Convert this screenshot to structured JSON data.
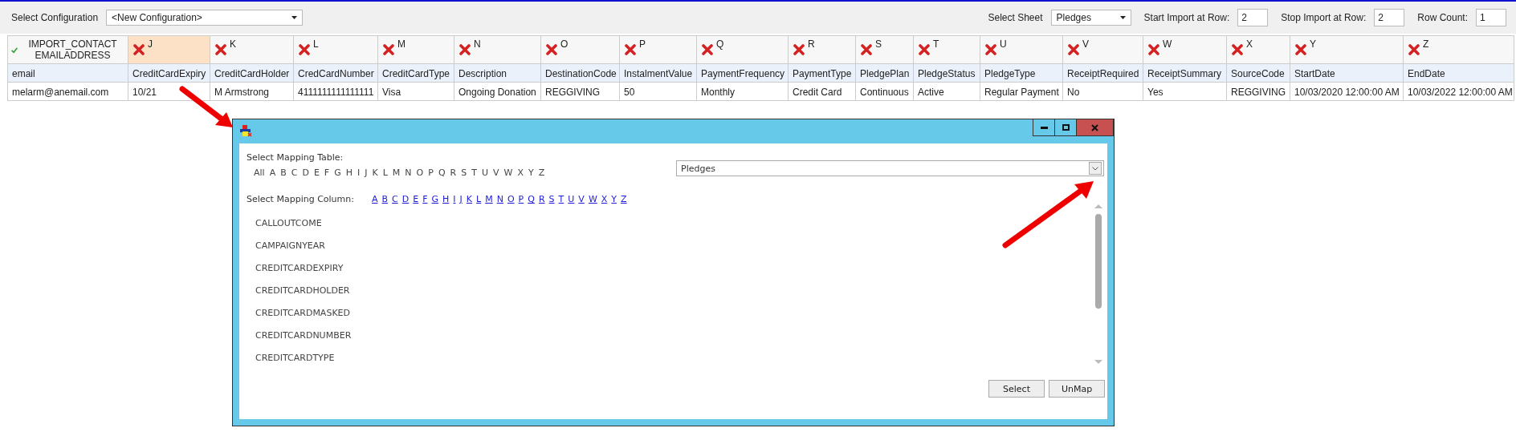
{
  "toolbar": {
    "configuration_label": "Select Configuration",
    "configuration_value": "<New Configuration>",
    "sheet_label": "Select Sheet",
    "sheet_value": "Pledges",
    "start_label": "Start Import at Row:",
    "start_value": "2",
    "stop_label": "Stop Import at Row:",
    "stop_value": "2",
    "count_label": "Row Count:",
    "count_value": "1"
  },
  "grid": {
    "columns": [
      {
        "header": "IMPORT_CONTACT EMAILADDRESS",
        "mapped": true,
        "selected": false
      },
      {
        "header": "J",
        "mapped": false,
        "selected": true
      },
      {
        "header": "K",
        "mapped": false,
        "selected": false
      },
      {
        "header": "L",
        "mapped": false,
        "selected": false
      },
      {
        "header": "M",
        "mapped": false,
        "selected": false
      },
      {
        "header": "N",
        "mapped": false,
        "selected": false
      },
      {
        "header": "O",
        "mapped": false,
        "selected": false
      },
      {
        "header": "P",
        "mapped": false,
        "selected": false
      },
      {
        "header": "Q",
        "mapped": false,
        "selected": false
      },
      {
        "header": "R",
        "mapped": false,
        "selected": false
      },
      {
        "header": "S",
        "mapped": false,
        "selected": false
      },
      {
        "header": "T",
        "mapped": false,
        "selected": false
      },
      {
        "header": "U",
        "mapped": false,
        "selected": false
      },
      {
        "header": "V",
        "mapped": false,
        "selected": false
      },
      {
        "header": "W",
        "mapped": false,
        "selected": false
      },
      {
        "header": "X",
        "mapped": false,
        "selected": false
      },
      {
        "header": "Y",
        "mapped": false,
        "selected": false
      },
      {
        "header": "Z",
        "mapped": false,
        "selected": false
      }
    ],
    "rows": [
      {
        "kind": "field",
        "cells": [
          "email",
          "CreditCardExpiry",
          "CreditCardHolder",
          "CredCardNumber",
          "CreditCardType",
          "Description",
          "DestinationCode",
          "InstalmentValue",
          "PaymentFrequency",
          "PaymentType",
          "PledgePlan",
          "PledgeStatus",
          "PledgeType",
          "ReceiptRequired",
          "ReceiptSummary",
          "SourceCode",
          "StartDate",
          "EndDate"
        ]
      },
      {
        "kind": "value",
        "cells": [
          "melarm@anemail.com",
          "10/21",
          "M Armstrong",
          "4111111111111111",
          "Visa",
          "Ongoing Donation",
          "REGGIVING",
          "50",
          "Monthly",
          "Credit Card",
          "Continuous",
          "Active",
          "Regular Payment",
          "No",
          "Yes",
          "REGGIVING",
          "10/03/2020 12:00:00 AM",
          "10/03/2022 12:00:00 AM"
        ]
      }
    ]
  },
  "dialog": {
    "table_label": "Select Mapping Table:",
    "table_letters": [
      "All",
      "A",
      "B",
      "C",
      "D",
      "E",
      "F",
      "G",
      "H",
      "I",
      "J",
      "K",
      "L",
      "M",
      "N",
      "O",
      "P",
      "Q",
      "R",
      "S",
      "T",
      "U",
      "V",
      "W",
      "X",
      "Y",
      "Z"
    ],
    "table_value": "Pledges",
    "column_label": "Select Mapping Column:",
    "column_letters": [
      "A",
      "B",
      "C",
      "D",
      "E",
      "F",
      "G",
      "H",
      "I",
      "J",
      "K",
      "L",
      "M",
      "N",
      "O",
      "P",
      "Q",
      "R",
      "S",
      "T",
      "U",
      "V",
      "W",
      "X",
      "Y",
      "Z"
    ],
    "columns": [
      "CALLOUTCOME",
      "CAMPAIGNYEAR",
      "CREDITCARDEXPIRY",
      "CREDITCARDHOLDER",
      "CREDITCARDMASKED",
      "CREDITCARDNUMBER",
      "CREDITCARDTYPE"
    ],
    "buttons": [
      "Select",
      "UnMap"
    ]
  }
}
